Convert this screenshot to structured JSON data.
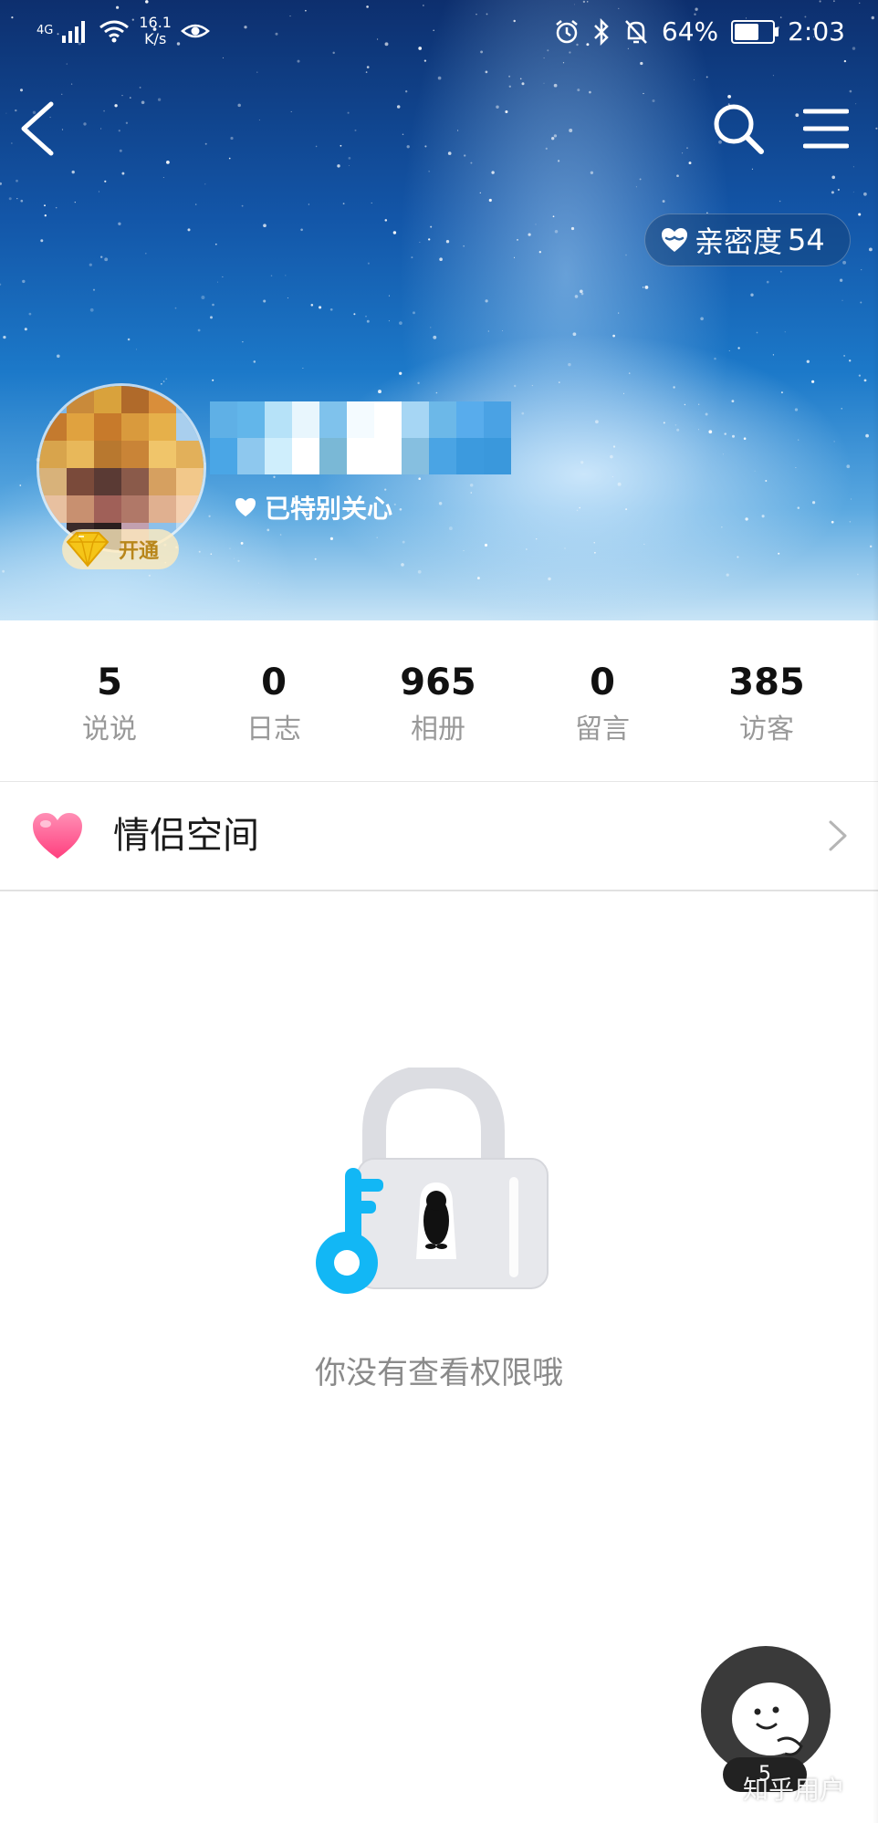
{
  "status_bar": {
    "network": "4G",
    "speed_value": "16.1",
    "speed_unit": "K/s",
    "battery": "64%",
    "battery_level": 0.64,
    "time": "2:03"
  },
  "header": {
    "intimacy_label": "亲密度",
    "intimacy_value": "54",
    "special_care": "已特别关心",
    "vip_label": "开通"
  },
  "stats": [
    {
      "value": "5",
      "label": "说说"
    },
    {
      "value": "0",
      "label": "日志"
    },
    {
      "value": "965",
      "label": "相册"
    },
    {
      "value": "0",
      "label": "留言"
    },
    {
      "value": "385",
      "label": "访客"
    }
  ],
  "couple_space": {
    "label": "情侣空间"
  },
  "locked": {
    "message": "你没有查看权限哦"
  },
  "floating": {
    "count": "5"
  },
  "watermark": "知乎用户",
  "colors": {
    "accent_blue": "#12B7F5",
    "heart_pink": "#FF5A8C",
    "text_gray": "#8A8A8A"
  },
  "icons": [
    "back-icon",
    "search-icon",
    "menu-icon",
    "heart-icon",
    "diamond-icon",
    "chevron-right-icon",
    "lock-icon",
    "key-icon",
    "penguin-icon",
    "mascot-icon"
  ]
}
